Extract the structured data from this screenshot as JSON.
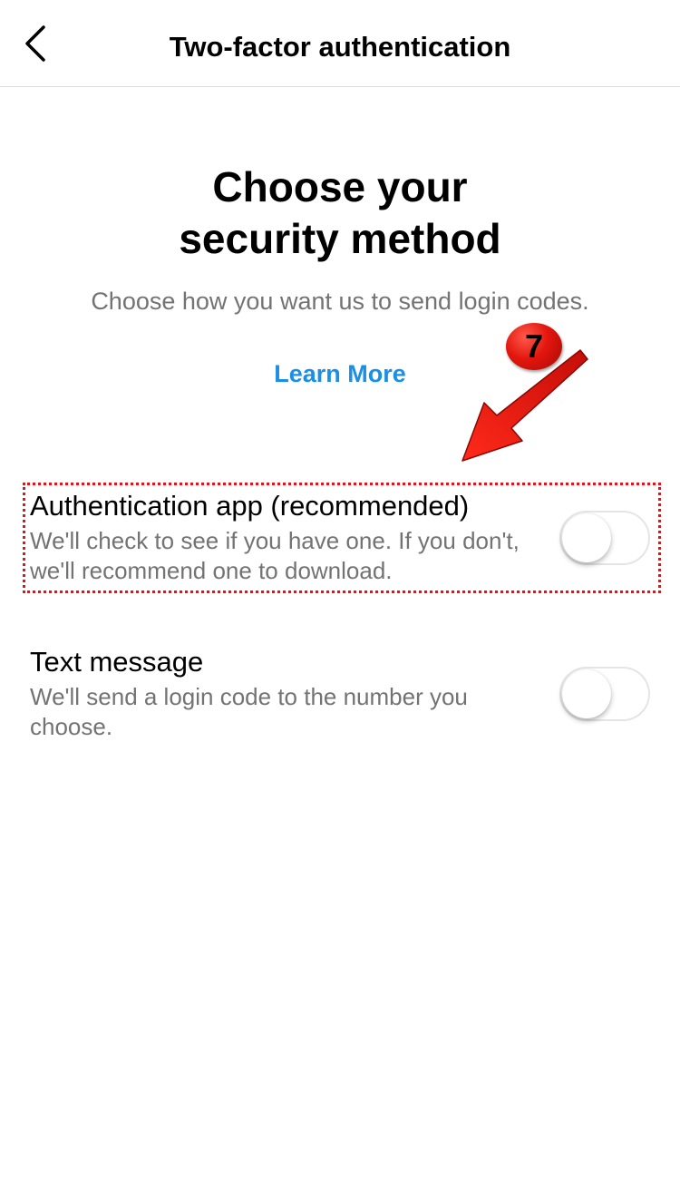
{
  "header": {
    "title": "Two-factor authentication",
    "back_icon": "chevron-left-icon"
  },
  "main": {
    "heading_line1": "Choose your",
    "heading_line2": "security method",
    "subtitle": "Choose how you want us to send login codes.",
    "learn_more": "Learn More"
  },
  "options": [
    {
      "title": "Authentication app (recommended)",
      "description": "We'll check to see if you have one. If you don't, we'll recommend one to download.",
      "enabled": false
    },
    {
      "title": "Text message",
      "description": "We'll send a login code to the number you choose.",
      "enabled": false
    }
  ],
  "annotation": {
    "step_number": "7",
    "color": "#e0141a"
  },
  "colors": {
    "link": "#1a8fe8",
    "secondary_text": "#737373",
    "divider": "#dbdbdb"
  }
}
